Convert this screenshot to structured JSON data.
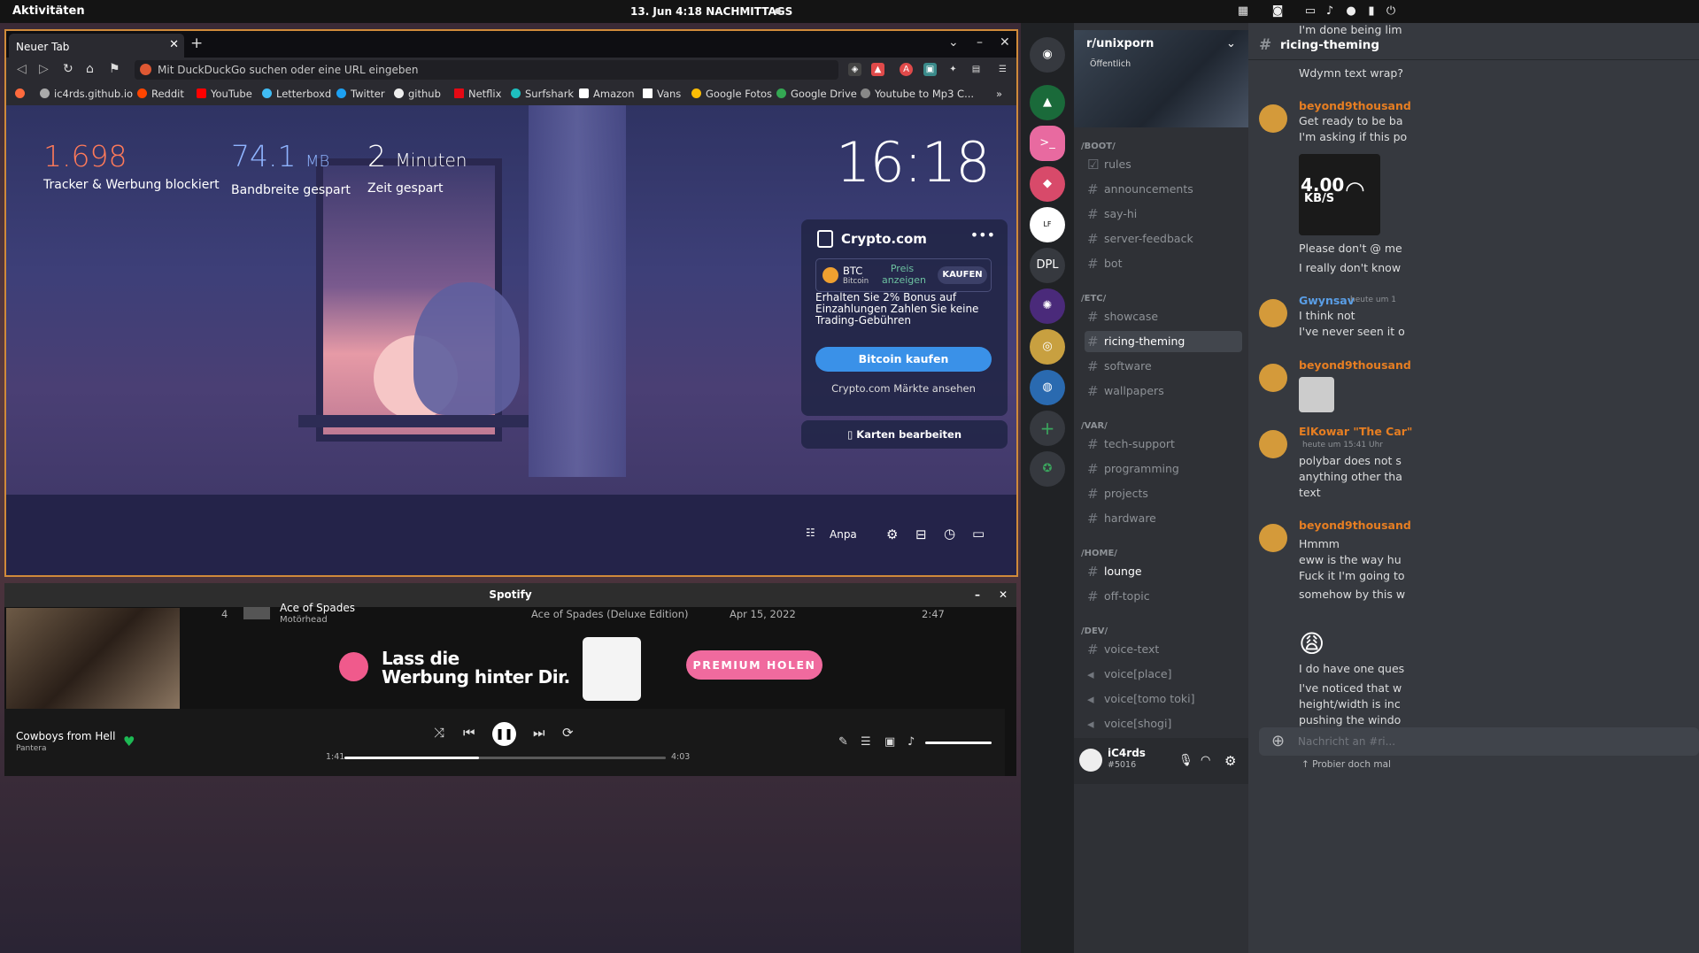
{
  "topbar": {
    "activities": "Aktivitäten",
    "datetime": "13. Jun  4:18 NACHMITTAGS"
  },
  "browser": {
    "tab_title": "Neuer Tab",
    "url_placeholder": "Mit DuckDuckGo suchen oder eine URL eingeben",
    "bookmarks": [
      "ic4rds.github.io",
      "Reddit",
      "YouTube",
      "Letterboxd",
      "Twitter",
      "github",
      "Netflix",
      "Surfshark",
      "Amazon",
      "Vans",
      "Google Fotos",
      "Google Drive",
      "Youtube to Mp3 C..."
    ],
    "stats": [
      {
        "value": "1.698",
        "unit": "",
        "label": "Tracker & Werbung blockiert",
        "color": "#ff7a59"
      },
      {
        "value": "74.1",
        "unit": "MB",
        "label": "Bandbreite gespart",
        "color": "#8fb4ff"
      },
      {
        "value": "2",
        "unit": "Minuten",
        "label": "Zeit gespart",
        "color": "#ffffff"
      }
    ],
    "clock": "16:18",
    "crypto": {
      "title": "Crypto.com",
      "symbol": "BTC",
      "name": "Bitcoin",
      "price": "Preis anzeigen",
      "buy_small": "KAUFEN",
      "promo": "Erhalten Sie 2% Bonus auf Einzahlungen Zahlen Sie keine Trading-Gebühren",
      "buy": "Bitcoin kaufen",
      "markets": "Crypto.com Märkte ansehen"
    },
    "edit_cards": "Karten bearbeiten",
    "customize": "Anpa"
  },
  "spotify": {
    "title": "Spotify",
    "row": {
      "num": "4",
      "title": "Ace of Spades",
      "artist": "Motörhead",
      "album": "Ace of Spades (Deluxe Edition)",
      "date": "Apr 15, 2022",
      "duration": "2:47"
    },
    "ad_slogan_1": "Lass die",
    "ad_slogan_2": "Werbung hinter Dir.",
    "ad_button": "PREMIUM HOLEN",
    "track": "Cowboys from Hell",
    "artist": "Pantera",
    "elapsed": "1:41",
    "total": "4:03",
    "progress": 0.42
  },
  "discord": {
    "server": "r/unixporn",
    "visibility": "Öffentlich",
    "categories": [
      {
        "name": "/BOOT/",
        "channels": [
          {
            "n": "rules",
            "icon": "rules"
          },
          {
            "n": "announcements"
          },
          {
            "n": "say-hi"
          },
          {
            "n": "server-feedback"
          },
          {
            "n": "bot"
          }
        ]
      },
      {
        "name": "/ETC/",
        "channels": [
          {
            "n": "showcase"
          },
          {
            "n": "ricing-theming",
            "active": true
          },
          {
            "n": "software"
          },
          {
            "n": "wallpapers"
          }
        ]
      },
      {
        "name": "/VAR/",
        "channels": [
          {
            "n": "tech-support"
          },
          {
            "n": "programming"
          },
          {
            "n": "projects"
          },
          {
            "n": "hardware"
          }
        ]
      },
      {
        "name": "/HOME/",
        "channels": [
          {
            "n": "lounge",
            "bright": true
          },
          {
            "n": "off-topic"
          }
        ]
      },
      {
        "name": "/DEV/",
        "channels": [
          {
            "n": "voice-text"
          },
          {
            "n": "voice[place]",
            "voice": true
          },
          {
            "n": "voice[tomo toki]",
            "voice": true
          },
          {
            "n": "voice[shogi]",
            "voice": true
          }
        ]
      }
    ],
    "user": "iC4rds",
    "tag": "#5016",
    "channel": "ricing-theming",
    "messages": [
      {
        "text": "Wdymn text wrap?"
      },
      {
        "author": "beyond9thousand",
        "lines": [
          "Get ready to be ba",
          "I'm asking if this po"
        ]
      },
      {
        "text": "Please don't @ me"
      },
      {
        "text": "I really don't know"
      },
      {
        "author": "Gwynsav",
        "time": "heute um 1",
        "lines": [
          "I think not",
          "I've never seen it o"
        ]
      },
      {
        "author": "beyond9thousand",
        "lines": []
      },
      {
        "author": "ElKowar \"The Car\"",
        "time": "heute um 15:41 Uhr",
        "lines": [
          "polybar does not s",
          "anything other tha",
          "text"
        ]
      },
      {
        "author": "beyond9thousand",
        "lines": [
          "Hmmm",
          "eww is the way hu",
          "Fuck it I'm going to",
          "somehow by this w",
          "I'm done being lim"
        ]
      },
      {
        "text": "I do have one ques"
      },
      {
        "text": "I've noticed that w"
      },
      {
        "text": "height/width is inc"
      },
      {
        "text": "pushing the windo"
      }
    ],
    "speed_value": "4.00",
    "speed_unit": "KB/S",
    "input_placeholder": "Nachricht an #ri...",
    "hint": "Probier doch mal"
  }
}
